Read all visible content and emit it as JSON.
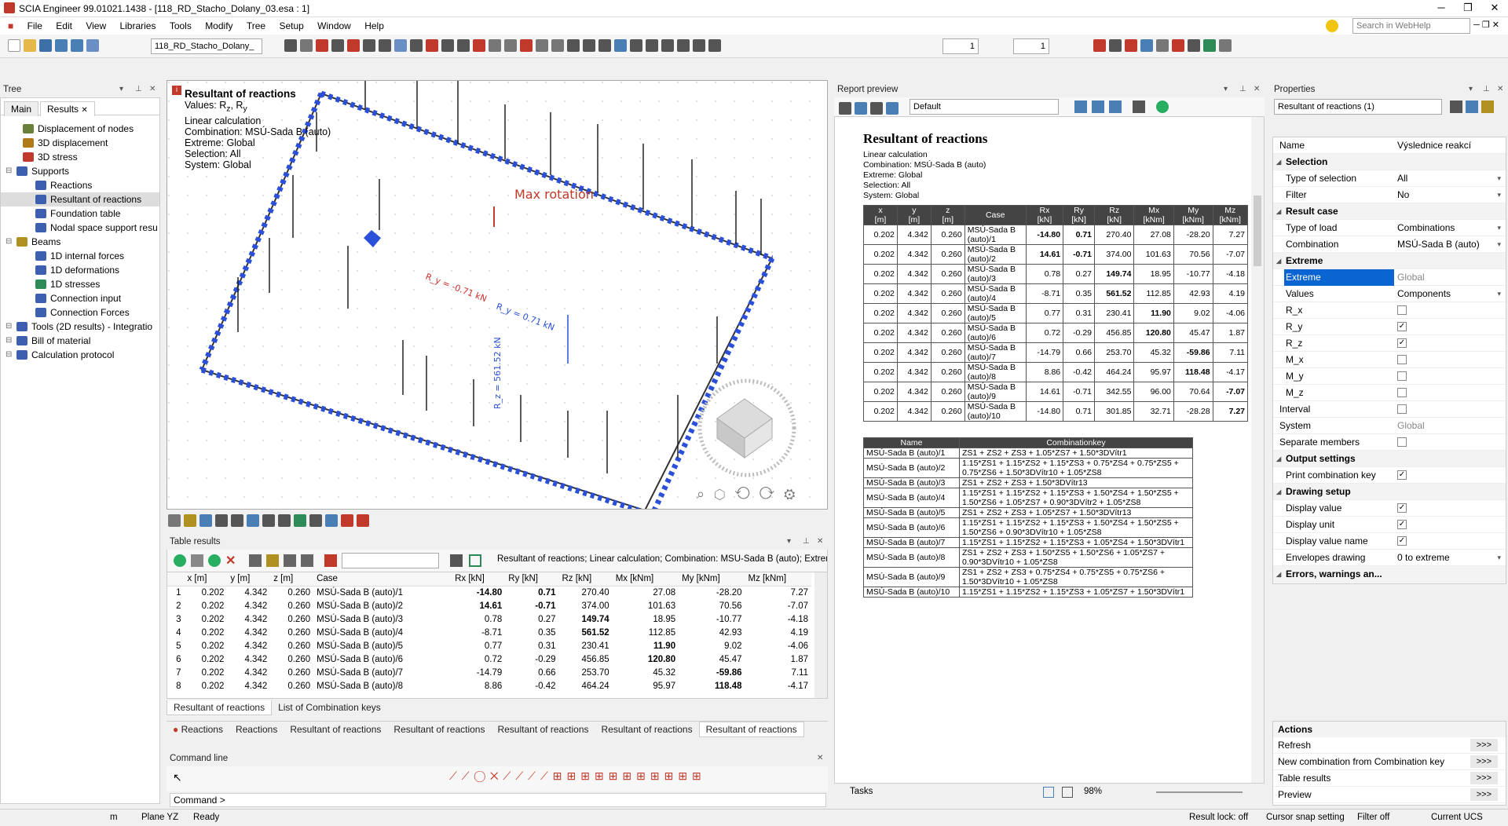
{
  "app": {
    "title": "SCIA Engineer 99.01021.1438 - [118_RD_Stacho_Dolany_03.esa : 1]",
    "menu": [
      "File",
      "Edit",
      "View",
      "Libraries",
      "Tools",
      "Modify",
      "Tree",
      "Setup",
      "Window",
      "Help"
    ],
    "search_placeholder": "Search in WebHelp",
    "project_select": "118_RD_Stacho_Dolany_",
    "spin1": "1",
    "spin2": "1"
  },
  "tree": {
    "title": "Tree",
    "tabs": [
      "Main",
      "Results"
    ],
    "items": [
      {
        "label": "Displacement of nodes",
        "level": 1,
        "color": "#6a7f3a"
      },
      {
        "label": "3D displacement",
        "level": 1,
        "color": "#b07a1a"
      },
      {
        "label": "3D stress",
        "level": 1,
        "color": "#c0392b"
      },
      {
        "label": "Supports",
        "level": 0,
        "color": "#3c5fb0"
      },
      {
        "label": "Reactions",
        "level": 2,
        "color": "#3c5fb0"
      },
      {
        "label": "Resultant of reactions",
        "level": 2,
        "color": "#3c5fb0"
      },
      {
        "label": "Foundation table",
        "level": 2,
        "color": "#3c5fb0"
      },
      {
        "label": "Nodal space support resu",
        "level": 2,
        "color": "#3c5fb0"
      },
      {
        "label": "Beams",
        "level": 0,
        "color": "#b09020"
      },
      {
        "label": "1D internal forces",
        "level": 2,
        "color": "#3c5fb0"
      },
      {
        "label": "1D deformations",
        "level": 2,
        "color": "#3c5fb0"
      },
      {
        "label": "1D stresses",
        "level": 2,
        "color": "#2e8b57"
      },
      {
        "label": "Connection input",
        "level": 2,
        "color": "#3c5fb0"
      },
      {
        "label": "Connection Forces",
        "level": 2,
        "color": "#3c5fb0"
      },
      {
        "label": "Tools (2D results) - Integratio",
        "level": 0,
        "color": "#3c5fb0"
      },
      {
        "label": "Bill of material",
        "level": 0,
        "color": "#3c5fb0"
      },
      {
        "label": "Calculation protocol",
        "level": 0,
        "color": "#3c5fb0"
      }
    ]
  },
  "viewport": {
    "header_title": "Resultant of reactions",
    "values_line": "Values: R",
    "values_sub1": "z",
    "values_sep": ", R",
    "values_sub2": "y",
    "lines": [
      "Linear calculation",
      "Combination: MSÚ-Sada B (auto)",
      "Extreme: Global",
      "Selection: All",
      "System: Global"
    ],
    "label_max_rotation": "Max rotation",
    "label_ry_neg": "R_y = -0.71 kN",
    "label_ry_pos": "R_y = 0.71 kN",
    "label_rz": "R_z = 561.52 kN"
  },
  "table_results": {
    "title": "Table results",
    "summary": "Resultant of reactions; Linear calculation; Combination: MSÚ-Sada B (auto); Extreme: Glob",
    "columns": [
      "",
      "x [m]",
      "y [m]",
      "z [m]",
      "Case",
      "Rx [kN]",
      "Ry [kN]",
      "Rz [kN]",
      "Mx [kNm]",
      "My [kNm]",
      "Mz [kNm]"
    ],
    "rows": [
      [
        "1",
        "0.202",
        "4.342",
        "0.260",
        "MSÚ-Sada B (auto)/1",
        "-14.80",
        "0.71",
        "270.40",
        "27.08",
        "-28.20",
        "7.27"
      ],
      [
        "2",
        "0.202",
        "4.342",
        "0.260",
        "MSÚ-Sada B (auto)/2",
        "14.61",
        "-0.71",
        "374.00",
        "101.63",
        "70.56",
        "-7.07"
      ],
      [
        "3",
        "0.202",
        "4.342",
        "0.260",
        "MSÚ-Sada B (auto)/3",
        "0.78",
        "0.27",
        "149.74",
        "18.95",
        "-10.77",
        "-4.18"
      ],
      [
        "4",
        "0.202",
        "4.342",
        "0.260",
        "MSÚ-Sada B (auto)/4",
        "-8.71",
        "0.35",
        "561.52",
        "112.85",
        "42.93",
        "4.19"
      ],
      [
        "5",
        "0.202",
        "4.342",
        "0.260",
        "MSÚ-Sada B (auto)/5",
        "0.77",
        "0.31",
        "230.41",
        "11.90",
        "9.02",
        "-4.06"
      ],
      [
        "6",
        "0.202",
        "4.342",
        "0.260",
        "MSÚ-Sada B (auto)/6",
        "0.72",
        "-0.29",
        "456.85",
        "120.80",
        "45.47",
        "1.87"
      ],
      [
        "7",
        "0.202",
        "4.342",
        "0.260",
        "MSÚ-Sada B (auto)/7",
        "-14.79",
        "0.66",
        "253.70",
        "45.32",
        "-59.86",
        "7.11"
      ],
      [
        "8",
        "0.202",
        "4.342",
        "0.260",
        "MSÚ-Sada B (auto)/8",
        "8.86",
        "-0.42",
        "464.24",
        "95.97",
        "118.48",
        "-4.17"
      ]
    ],
    "bold": [
      [
        5,
        6
      ],
      [
        5,
        6
      ],
      [
        7
      ],
      [
        7
      ],
      [
        8
      ],
      [
        8
      ],
      [
        9
      ],
      [
        9
      ]
    ],
    "subtabs": [
      "Resultant of reactions",
      "List of Combination keys"
    ],
    "bottom_tabs": [
      "Reactions",
      "Reactions",
      "Resultant of reactions",
      "Resultant of reactions",
      "Resultant of reactions",
      "Resultant of reactions",
      "Resultant of reactions"
    ]
  },
  "command": {
    "title": "Command line",
    "prompt": "Command >"
  },
  "report": {
    "title": "Report preview",
    "template": "Default",
    "heading": "Resultant of reactions",
    "lines": [
      "Linear calculation",
      "Combination: MSÚ-Sada B (auto)",
      "Extreme: Global",
      "Selection: All",
      "System: Global"
    ],
    "columns": [
      "x\n[m]",
      "y\n[m]",
      "z\n[m]",
      "Case",
      "Rx\n[kN]",
      "Ry\n[kN]",
      "Rz\n[kN]",
      "Mx\n[kNm]",
      "My\n[kNm]",
      "Mz\n[kNm]"
    ],
    "rows": [
      [
        "0.202",
        "4.342",
        "0.260",
        "MSÚ-Sada B (auto)/1",
        "-14.80",
        "0.71",
        "270.40",
        "27.08",
        "-28.20",
        "7.27"
      ],
      [
        "0.202",
        "4.342",
        "0.260",
        "MSÚ-Sada B (auto)/2",
        "14.61",
        "-0.71",
        "374.00",
        "101.63",
        "70.56",
        "-7.07"
      ],
      [
        "0.202",
        "4.342",
        "0.260",
        "MSÚ-Sada B (auto)/3",
        "0.78",
        "0.27",
        "149.74",
        "18.95",
        "-10.77",
        "-4.18"
      ],
      [
        "0.202",
        "4.342",
        "0.260",
        "MSÚ-Sada B (auto)/4",
        "-8.71",
        "0.35",
        "561.52",
        "112.85",
        "42.93",
        "4.19"
      ],
      [
        "0.202",
        "4.342",
        "0.260",
        "MSÚ-Sada B (auto)/5",
        "0.77",
        "0.31",
        "230.41",
        "11.90",
        "9.02",
        "-4.06"
      ],
      [
        "0.202",
        "4.342",
        "0.260",
        "MSÚ-Sada B (auto)/6",
        "0.72",
        "-0.29",
        "456.85",
        "120.80",
        "45.47",
        "1.87"
      ],
      [
        "0.202",
        "4.342",
        "0.260",
        "MSÚ-Sada B (auto)/7",
        "-14.79",
        "0.66",
        "253.70",
        "45.32",
        "-59.86",
        "7.11"
      ],
      [
        "0.202",
        "4.342",
        "0.260",
        "MSÚ-Sada B (auto)/8",
        "8.86",
        "-0.42",
        "464.24",
        "95.97",
        "118.48",
        "-4.17"
      ],
      [
        "0.202",
        "4.342",
        "0.260",
        "MSÚ-Sada B (auto)/9",
        "14.61",
        "-0.71",
        "342.55",
        "96.00",
        "70.64",
        "-7.07"
      ],
      [
        "0.202",
        "4.342",
        "0.260",
        "MSÚ-Sada B (auto)/10",
        "-14.80",
        "0.71",
        "301.85",
        "32.71",
        "-28.28",
        "7.27"
      ]
    ],
    "bold": [
      [
        4,
        5
      ],
      [
        4,
        5
      ],
      [
        6
      ],
      [
        6
      ],
      [
        7
      ],
      [
        7
      ],
      [
        8
      ],
      [
        8
      ],
      [
        9
      ],
      [
        9
      ]
    ],
    "key_columns": [
      "Name",
      "Combinationkey"
    ],
    "keys": [
      [
        "MSÚ-Sada B (auto)/1",
        "ZS1 + ZS2 + ZS3 + 1.05*ZS7 + 1.50*3DVítr1"
      ],
      [
        "MSÚ-Sada B (auto)/2",
        "1.15*ZS1 + 1.15*ZS2 + 1.15*ZS3 + 0.75*ZS4 + 0.75*ZS5 + 0.75*ZS6 + 1.50*3DVítr10 + 1.05*ZS8"
      ],
      [
        "MSÚ-Sada B (auto)/3",
        "ZS1 + ZS2 + ZS3 + 1.50*3DVítr13"
      ],
      [
        "MSÚ-Sada B (auto)/4",
        "1.15*ZS1 + 1.15*ZS2 + 1.15*ZS3 + 1.50*ZS4 + 1.50*ZS5 + 1.50*ZS6 + 1.05*ZS7 + 0.90*3DVítr2 + 1.05*ZS8"
      ],
      [
        "MSÚ-Sada B (auto)/5",
        "ZS1 + ZS2 + ZS3 + 1.05*ZS7 + 1.50*3DVítr13"
      ],
      [
        "MSÚ-Sada B (auto)/6",
        "1.15*ZS1 + 1.15*ZS2 + 1.15*ZS3 + 1.50*ZS4 + 1.50*ZS5 + 1.50*ZS6 + 0.90*3DVítr10 + 1.05*ZS8"
      ],
      [
        "MSÚ-Sada B (auto)/7",
        "1.15*ZS1 + 1.15*ZS2 + 1.15*ZS3 + 1.05*ZS4 + 1.50*3DVítr1"
      ],
      [
        "MSÚ-Sada B (auto)/8",
        "ZS1 + ZS2 + ZS3 + 1.50*ZS5 + 1.50*ZS6 + 1.05*ZS7 + 0.90*3DVítr10 + 1.05*ZS8"
      ],
      [
        "MSÚ-Sada B (auto)/9",
        "ZS1 + ZS2 + ZS3 + 0.75*ZS4 + 0.75*ZS5 + 0.75*ZS6 + 1.50*3DVítr10 + 1.05*ZS8"
      ],
      [
        "MSÚ-Sada B (auto)/10",
        "1.15*ZS1 + 1.15*ZS2 + 1.15*ZS3 + 1.05*ZS7 + 1.50*3DVítr1"
      ]
    ],
    "tasks_label": "Tasks",
    "zoom": "98%"
  },
  "properties": {
    "title": "Properties",
    "selector": "Resultant of reactions (1)",
    "rows": [
      {
        "k": "Name",
        "v": "Výslednice reakcí",
        "type": "text"
      },
      {
        "k": "Selection",
        "type": "group"
      },
      {
        "k": "Type of selection",
        "v": "All",
        "type": "select"
      },
      {
        "k": "Filter",
        "v": "No",
        "type": "select"
      },
      {
        "k": "Result case",
        "type": "group"
      },
      {
        "k": "Type of load",
        "v": "Combinations",
        "type": "select"
      },
      {
        "k": "Combination",
        "v": "MSÚ-Sada B (auto)",
        "type": "select"
      },
      {
        "k": "Extreme",
        "type": "group"
      },
      {
        "k": "Extreme",
        "v": "Global",
        "type": "highlight"
      },
      {
        "k": "Values",
        "v": "Components",
        "type": "select"
      },
      {
        "k": "R_x",
        "v": "",
        "type": "check"
      },
      {
        "k": "R_y",
        "v": "✓",
        "type": "check"
      },
      {
        "k": "R_z",
        "v": "✓",
        "type": "check"
      },
      {
        "k": "M_x",
        "v": "",
        "type": "check"
      },
      {
        "k": "M_y",
        "v": "",
        "type": "check"
      },
      {
        "k": "M_z",
        "v": "",
        "type": "check"
      },
      {
        "k": "Interval",
        "v": "",
        "type": "check0"
      },
      {
        "k": "System",
        "v": "Global",
        "type": "grey0"
      },
      {
        "k": "Separate members",
        "v": "",
        "type": "check0"
      },
      {
        "k": "Output settings",
        "type": "group"
      },
      {
        "k": "Print combination key",
        "v": "✓",
        "type": "check"
      },
      {
        "k": "Drawing setup",
        "type": "group"
      },
      {
        "k": "Display value",
        "v": "✓",
        "type": "check"
      },
      {
        "k": "Display unit",
        "v": "✓",
        "type": "check"
      },
      {
        "k": "Display value name",
        "v": "✓",
        "type": "check"
      },
      {
        "k": "Envelopes drawing",
        "v": "0 to extreme",
        "type": "select"
      },
      {
        "k": "Errors, warnings an...",
        "type": "group"
      }
    ],
    "actions_title": "Actions",
    "actions": [
      "Refresh",
      "New combination from Combination key",
      "Table results",
      "Preview"
    ],
    "arrow": ">>>"
  },
  "status": {
    "unit": "m",
    "plane": "Plane YZ",
    "state": "Ready",
    "result_lock": "Result lock: off",
    "cursor_snap": "Cursor snap setting",
    "filter": "Filter off",
    "ucs": "Current UCS"
  }
}
